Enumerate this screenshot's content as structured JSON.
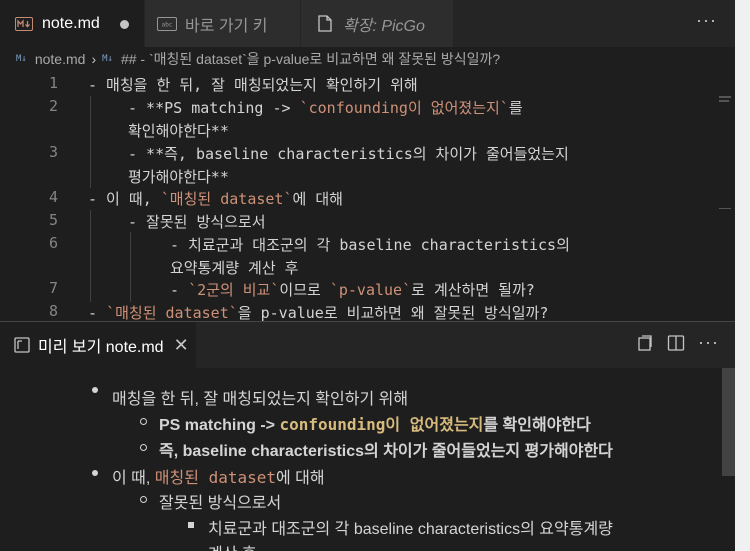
{
  "tabs": [
    {
      "label": "note.md",
      "icon": "markdown-icon"
    },
    {
      "label": "바로 가기 키",
      "icon": "keyboard-icon"
    },
    {
      "label": "확장: PicGo",
      "icon": "file-icon"
    }
  ],
  "breadcrumb": {
    "file": "note.md",
    "heading": "## - `매칭된 dataset`을 p-value로 비교하면 왜 잘못된 방식일까?"
  },
  "editor": {
    "line_numbers": [
      "1",
      "2",
      "3",
      "4",
      "5",
      "6",
      "7",
      "8"
    ],
    "lines": [
      {
        "text": "- 매칭을 한 뒤, 잘 매칭되었는지 확인하기 위해"
      },
      {
        "p1": "- **PS matching -> ",
        "code": "`confounding이 없어졌는지`",
        "p2": "를"
      },
      {
        "text": "확인해야한다**"
      },
      {
        "text": "- **즉, baseline characteristics의 차이가 줄어들었는지"
      },
      {
        "text": "평가해야한다**"
      },
      {
        "p1": "- 이 때, ",
        "code": "`매칭된 dataset`",
        "p2": "에 대해"
      },
      {
        "text": "- 잘못된 방식으로서"
      },
      {
        "text": "- 치료군과 대조군의 각 baseline characteristics의"
      },
      {
        "text": "요약통계량 계산 후"
      },
      {
        "p1": "- ",
        "code": "`2군의 비교`",
        "p2": "이므로 ",
        "code2": "`p-value`",
        "p3": "로 계산하면 될까?"
      },
      {
        "p1": "- ",
        "code": "`매칭된 dataset`",
        "p2": "을 p-value로 비교하면 왜 잘못된 방식일까?"
      }
    ]
  },
  "preview": {
    "tab_label": "미리 보기 note.md",
    "items": [
      {
        "text": "매칭을 한 뒤, 잘 매칭되었는지 확인하기 위해"
      },
      {
        "p1": "PS matching -> ",
        "code": "confounding이 없어졌는지",
        "p2": "를 확인해야한다"
      },
      {
        "text": "즉, baseline characteristics의 차이가 줄어들었는지 평가해야한다"
      },
      {
        "p1": "이 때, ",
        "code": "매칭된 dataset",
        "p2": "에 대해"
      },
      {
        "text": "잘못된 방식으로서"
      },
      {
        "text": "치료군과 대조군의 각 baseline characteristics의 요약통계량"
      },
      {
        "text": "계산 후"
      }
    ]
  },
  "colors": {
    "accent": "#ce9178",
    "code_inline": "#d7ba7d",
    "background": "#1e1e1e"
  }
}
